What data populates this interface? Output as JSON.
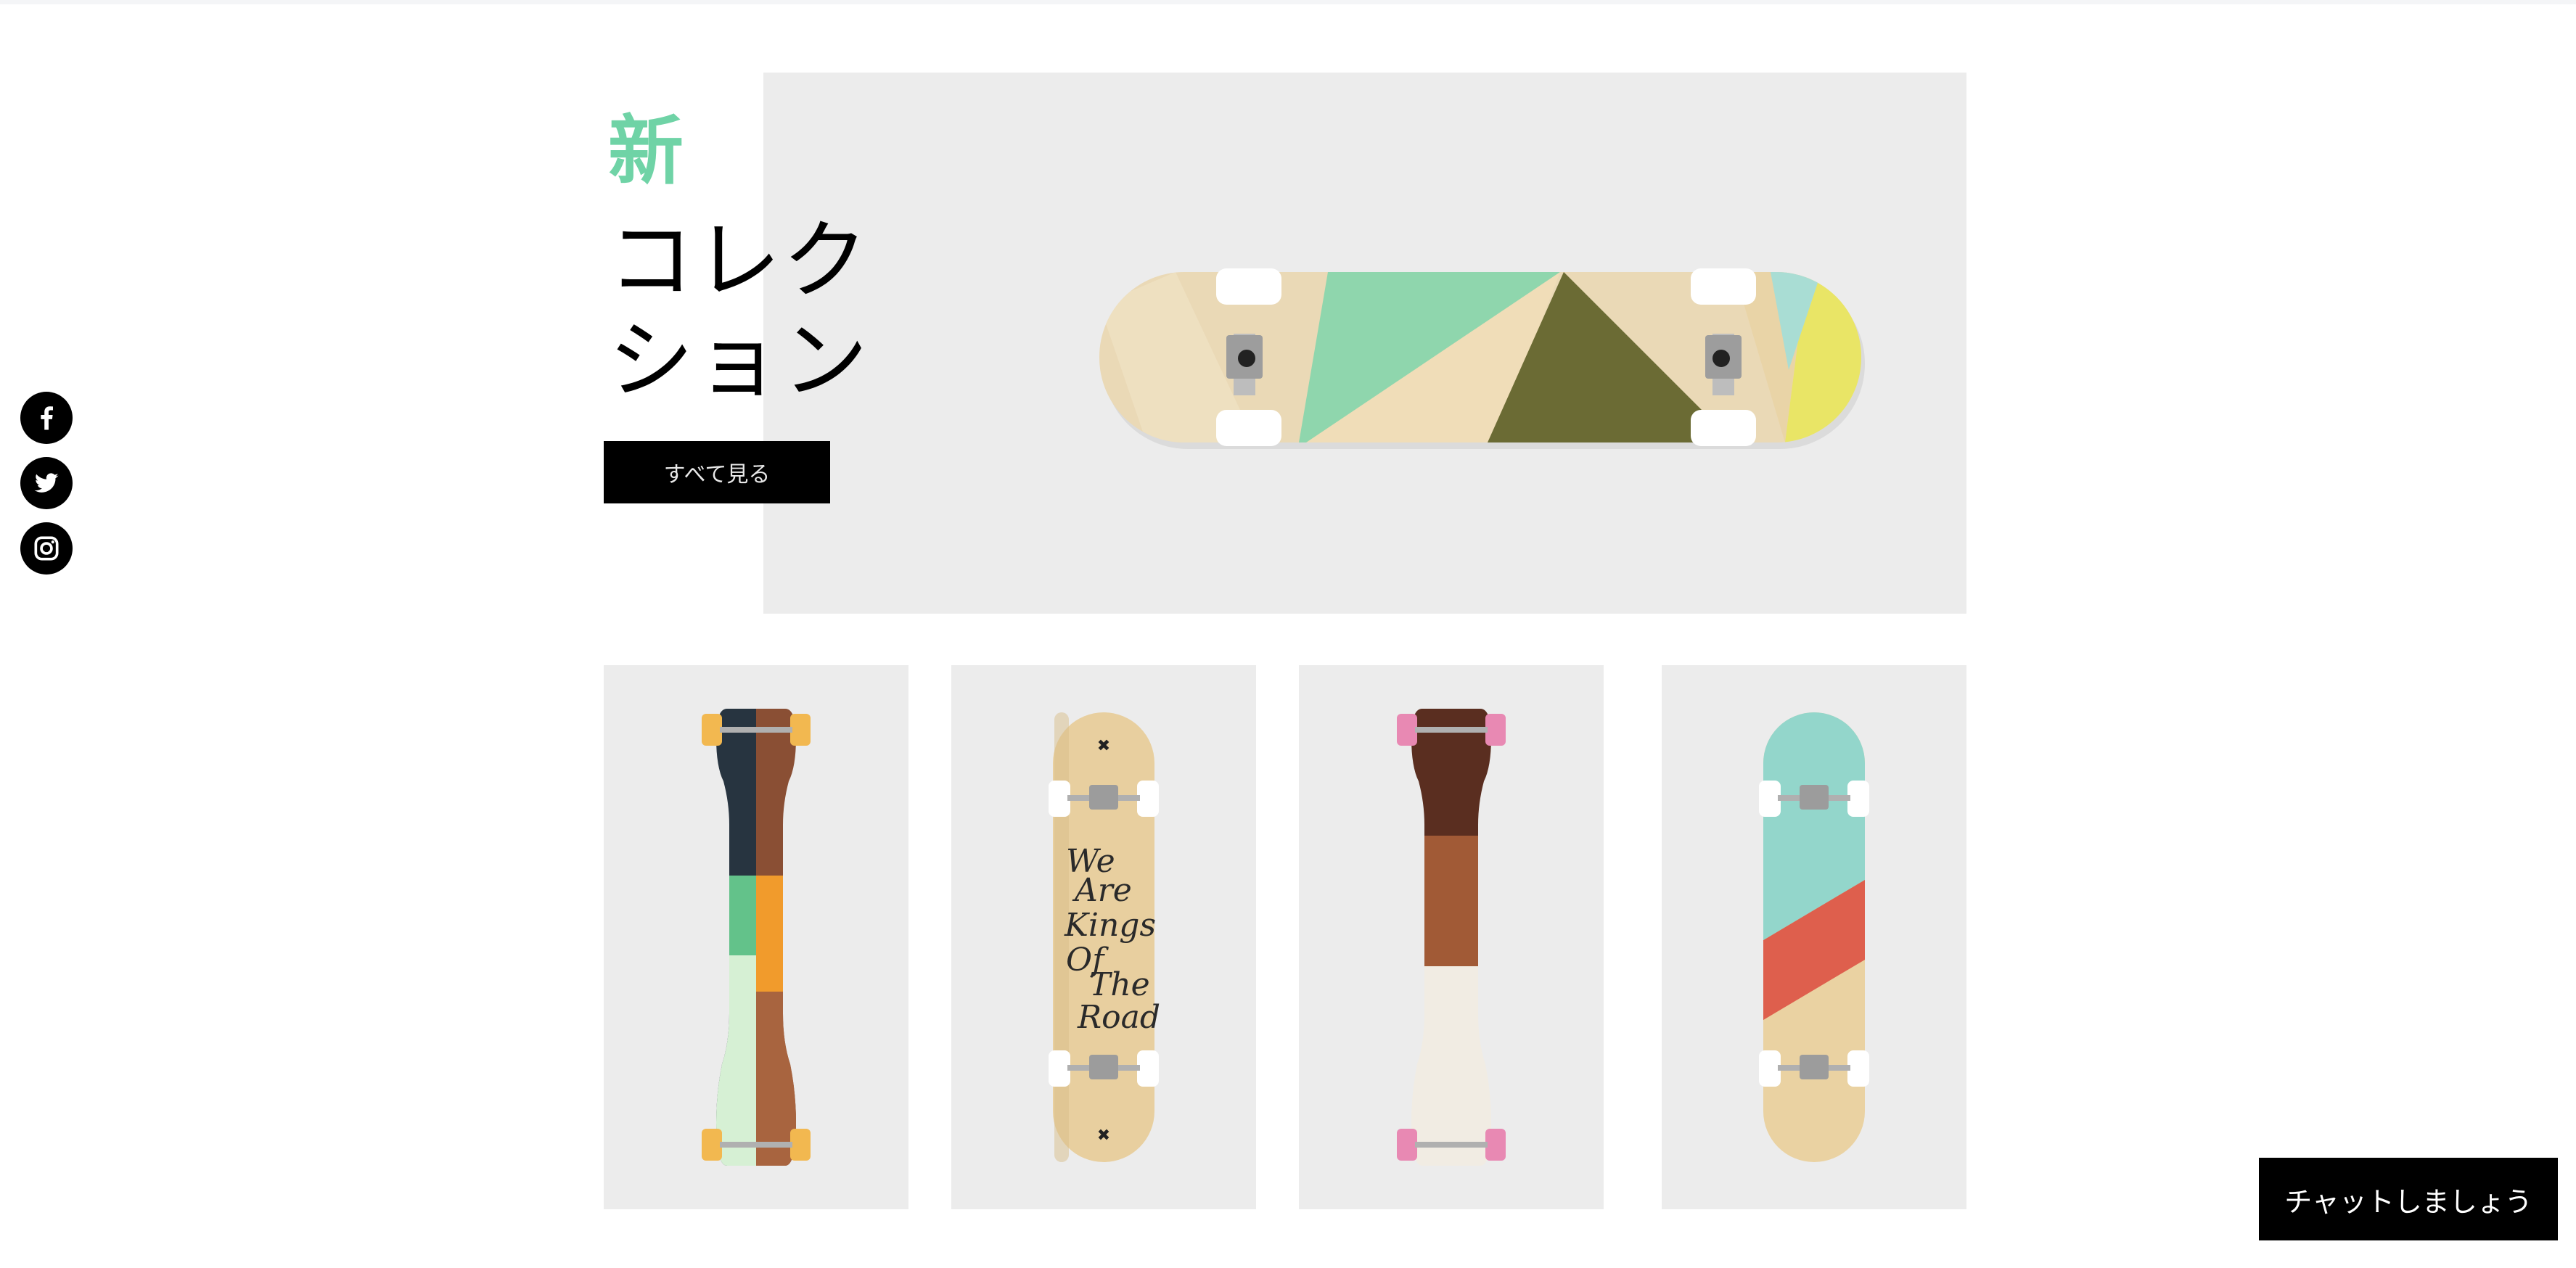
{
  "hero": {
    "title_accent": "新",
    "title_line1": "コレク",
    "title_line2": "ション",
    "button_label": "すべて見る"
  },
  "social": [
    {
      "icon": "facebook-icon"
    },
    {
      "icon": "twitter-icon"
    },
    {
      "icon": "instagram-icon"
    }
  ],
  "products": [
    {
      "name": "dropthrough-longboard-navy-green"
    },
    {
      "name": "pintail-we-are-kings-of-the-road"
    },
    {
      "name": "dropthrough-longboard-walnut-white"
    },
    {
      "name": "cruiser-mint-coral-stripe"
    }
  ],
  "board_art_text": [
    "We",
    "Are",
    "Kings",
    "Of",
    "The",
    "Road"
  ],
  "chat": {
    "label": "チャットしましょう"
  },
  "colors": {
    "accent": "#6fd3a6",
    "panel": "#ececec",
    "button": "#000000"
  }
}
